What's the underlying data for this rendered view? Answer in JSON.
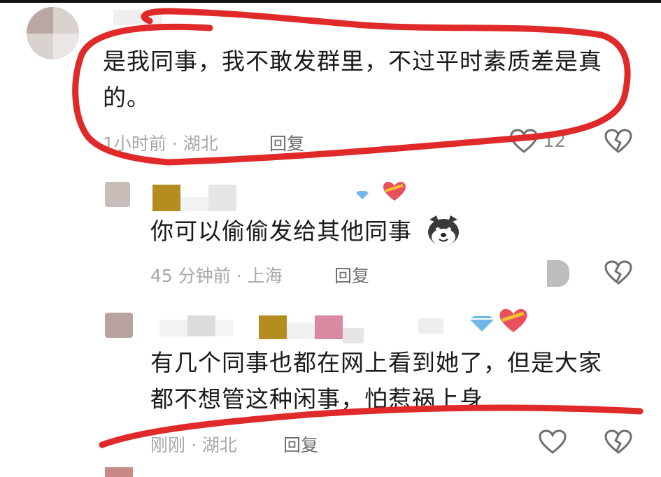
{
  "comment1": {
    "text": "是我同事，我不敢发群里，不过平时素质差是真的。",
    "line1": "是我同事，我不敢发群里，不过平时素质差是真",
    "line2": "的。",
    "meta": "1小时前 · 湖北",
    "reply_label": "回复",
    "like_count": "12"
  },
  "comment2": {
    "text": "你可以偷偷发给其他同事",
    "meta": "45 分钟前 · 上海",
    "reply_label": "回复"
  },
  "comment3": {
    "line1": "有几个同事也都在网上看到她了，但是大家",
    "line2": "都不想管这种闲事，怕惹祸上身",
    "meta": "刚刚 · 湖北",
    "reply_label": "回复"
  },
  "icons": {
    "like": "heart-outline-icon",
    "dislike": "broken-heart-icon",
    "husky_emoji": "husky-dog-emoji",
    "heart_badge": "heart-badge-icon",
    "diamond_badge": "diamond-badge-icon"
  },
  "colors": {
    "annotation_red": "#e02a2a",
    "text": "#1a1a1a",
    "meta_gray": "#a8a8a8"
  }
}
